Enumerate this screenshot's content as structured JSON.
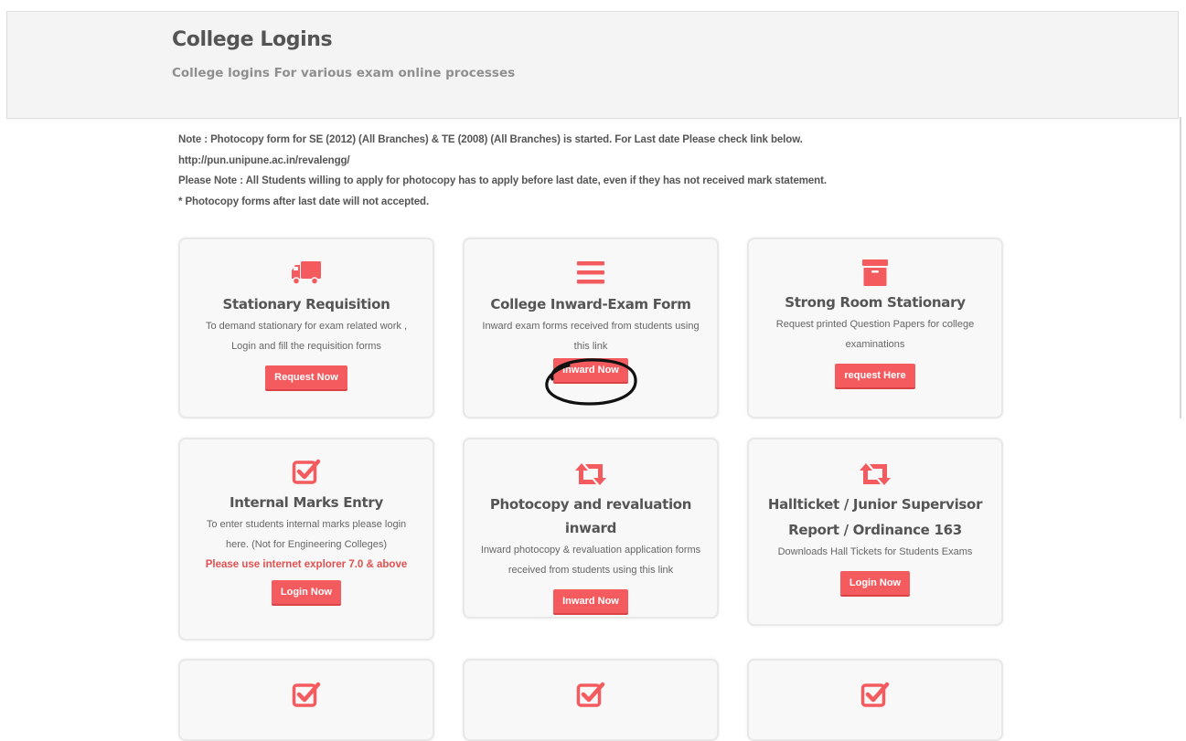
{
  "header": {
    "title": "College Logins",
    "subtitle": "College logins For various exam online processes"
  },
  "notes": [
    "Note : Photocopy form for SE (2012) (All Branches) & TE (2008) (All Branches) is started. For Last date Please check link below.",
    "http://pun.unipune.ac.in/revalengg/",
    "Please Note : All Students willing to apply for photocopy has to apply before last date, even if they has not received mark statement.",
    "* Photocopy forms after last date will not accepted."
  ],
  "colors": {
    "accent": "#f45b5f",
    "card_bg": "#f8f8f8",
    "warning": "#e35050"
  },
  "cards": [
    {
      "icon": "truck-icon",
      "title": "Stationary Requisition",
      "desc_lines": [
        "To demand stationary for exam related work ,",
        "Login and fill the requisition forms"
      ],
      "button": "Request Now"
    },
    {
      "icon": "list-icon",
      "title": "College Inward-Exam Form",
      "desc_lines": [
        "Inward exam forms received from students using",
        "this link"
      ],
      "button": "Inward Now"
    },
    {
      "icon": "archive-icon",
      "title": "Strong Room Stationary",
      "desc_lines": [
        "Request printed Question Papers for college",
        "examinations"
      ],
      "button": "request Here"
    },
    {
      "icon": "checkbox-icon",
      "title": "Internal Marks Entry",
      "desc_lines": [
        "To enter students internal marks please login",
        "here. (Not for Engineering Colleges)"
      ],
      "warning": "Please use internet explorer 7.0 & above",
      "button": "Login Now"
    },
    {
      "icon": "retweet-icon",
      "title": "Photocopy and revaluation inward",
      "desc_lines": [
        "Inward photocopy & revaluation application forms",
        "received from students using this link"
      ],
      "button": "Inward Now"
    },
    {
      "icon": "retweet-icon",
      "title_lines": [
        "Hallticket / Junior Supervisor",
        "Report / Ordinance 163"
      ],
      "desc_lines": [
        "Downloads Hall Tickets for Students Exams"
      ],
      "button": "Login Now"
    },
    {
      "icon": "checkbox-icon"
    },
    {
      "icon": "checkbox-icon"
    },
    {
      "icon": "checkbox-icon"
    }
  ]
}
